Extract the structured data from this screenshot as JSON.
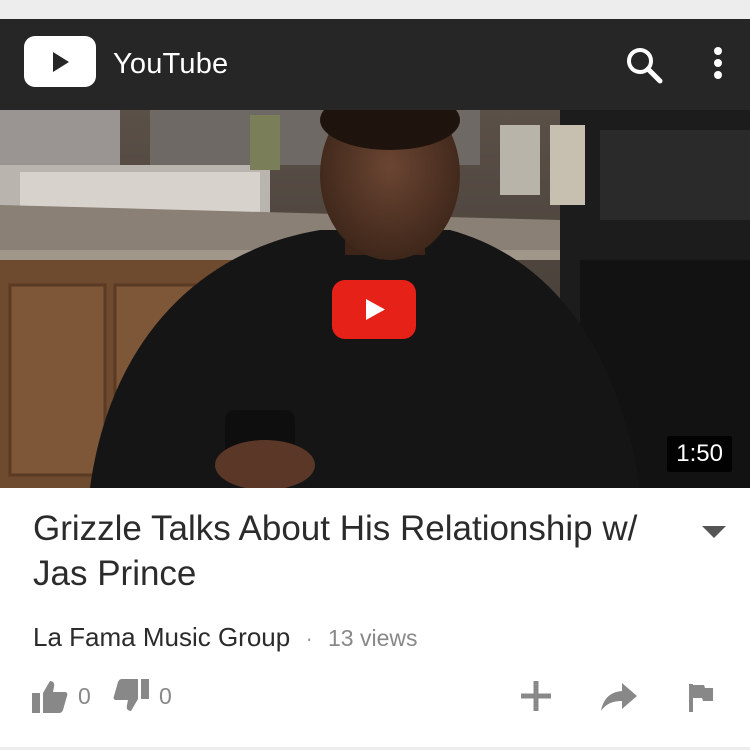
{
  "app": {
    "title": "YouTube"
  },
  "icons": {
    "logo": "youtube-logo-icon",
    "search": "search-icon",
    "more": "more-vert-icon",
    "play": "play-icon",
    "expand": "caret-down-icon",
    "like": "thumbs-up-icon",
    "dislike": "thumbs-down-icon",
    "add": "plus-icon",
    "share": "share-icon",
    "flag": "flag-icon"
  },
  "video": {
    "duration": "1:50",
    "title": "Grizzle Talks About His Relationship w/ Jas Prince",
    "channel": "La Fama Music Group",
    "separator": "·",
    "views": "13 views",
    "likes": "0",
    "dislikes": "0"
  },
  "colors": {
    "topbar": "#262626",
    "play_red": "#e62117",
    "icon_gray": "#888888",
    "text": "#2b2b2b"
  }
}
